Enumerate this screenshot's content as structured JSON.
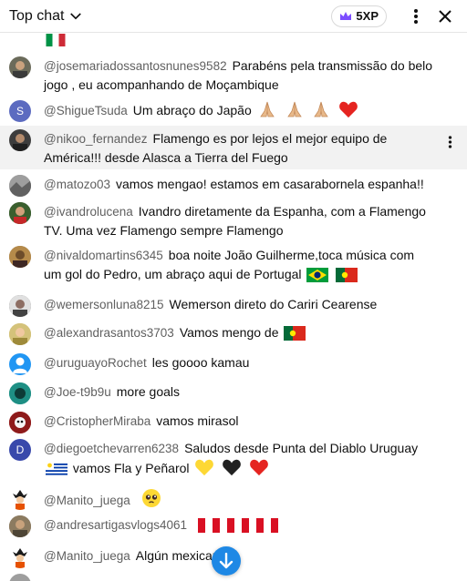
{
  "header": {
    "title": "Top chat",
    "xp_label": "5XP"
  },
  "messages": [
    {
      "author": "@josemariadossantosnunes9582",
      "text": "Parabéns pela transmissão do belo jogo , eu acompanhando de Moçambique",
      "emojis": []
    },
    {
      "author": "@ShigueTsuda",
      "text": "Um abraço do Japão",
      "emojis": [
        "pray",
        "pray",
        "pray",
        "heart-red"
      ],
      "avatar_letter": "S"
    },
    {
      "author": "@nikoo_fernandez",
      "text": "Flamengo es por lejos el mejor equipo de América!!! desde Alasca a Tierra del Fuego",
      "emojis": []
    },
    {
      "author": "@matozo03",
      "text": "vamos mengao! estamos em casarabornela espanha!!",
      "emojis": []
    },
    {
      "author": "@ivandrolucena",
      "text": "Ivandro diretamente da Espanha, com a Flamengo TV. Uma vez Flamengo sempre Flamengo",
      "emojis": []
    },
    {
      "author": "@nivaldomartins6345",
      "text": "boa noite João Guilherme,toca música com um gol do Pedro, um abraço aqui de Portugal",
      "emojis": [
        "flag-brazil",
        "flag-portugal"
      ]
    },
    {
      "author": "@wemersonluna8215",
      "text": "Wemerson direto do Cariri Cearense",
      "emojis": []
    },
    {
      "author": "@alexandrasantos3703",
      "text": "Vamos mengo de",
      "emojis": [
        "flag-portugal"
      ]
    },
    {
      "author": "@uruguayoRochet",
      "text": "les goooo kamau",
      "emojis": []
    },
    {
      "author": "@Joe-t9b9u",
      "text": "more goals",
      "emojis": []
    },
    {
      "author": "@CristopherMiraba",
      "text": "vamos mirasol",
      "emojis": []
    },
    {
      "author": "@diegoetchevarren6238",
      "text": "Saludos desde Punta del Diablo Uruguay",
      "text2": "vamos Fla y Peñarol",
      "emojis": [
        "flag-uruguay",
        "heart-yellow",
        "heart-black",
        "heart-red"
      ],
      "avatar_letter": "D"
    },
    {
      "author": "@Manito_juega",
      "text": "",
      "emojis": [
        "pleading-face"
      ]
    },
    {
      "author": "@andresartigasvlogs4061",
      "text": "",
      "emojis": [
        "flag-peru",
        "flag-peru",
        "flag-peru"
      ]
    },
    {
      "author": "@Manito_juega",
      "text": "Algún mexicano?",
      "emojis": []
    }
  ],
  "colors": {
    "author": "#606060",
    "text": "#0f0f0f",
    "highlight": "#f2f2f2",
    "scroll_button": "#1e88e5",
    "badge_crown": "#7c4dff"
  }
}
